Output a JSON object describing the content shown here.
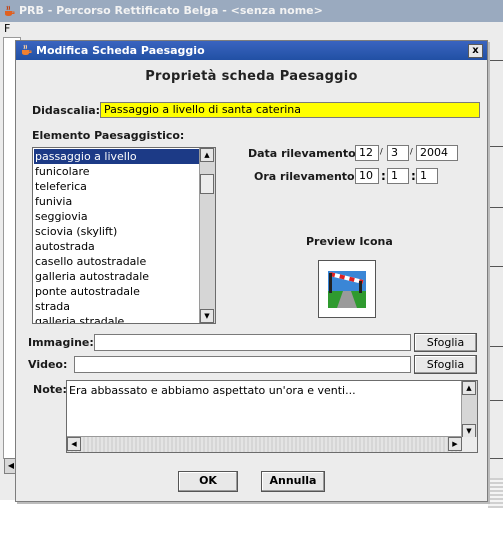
{
  "bg_window": {
    "title": "PRB - Percorso Rettificato Belga - <senza nome>",
    "menu_first_letter": "F"
  },
  "dialog": {
    "title": "Modifica Scheda Paesaggio",
    "close_label": "x",
    "heading": "Proprietà scheda Paesaggio",
    "caption_label": "Didascalia:",
    "caption_value": "Passaggio a livello di santa caterina",
    "element_label": "Elemento Paesaggistico:",
    "elements": [
      "passaggio a livello",
      "funicolare",
      "teleferica",
      "funivia",
      "seggiovia",
      "sciovia (skylift)",
      "autostrada",
      "casello autostradale",
      "galleria autostradale",
      "ponte autostradale",
      "strada",
      "galleria stradale"
    ],
    "selected_index": 0,
    "date_label": "Data rilevamento:",
    "date_day": "12",
    "date_month": "3",
    "date_year": "2004",
    "date_sep": "/",
    "time_label": "Ora rilevamento:",
    "time_h": "10",
    "time_m": "1",
    "time_s": "1",
    "time_sep": ":",
    "preview_label": "Preview Icona",
    "image_label": "Immagine:",
    "image_value": "",
    "video_label": "Video:",
    "video_value": "",
    "browse_label": "Sfoglia",
    "notes_label": "Note:",
    "notes_value": "Era abbassato e abbiamo aspettato un'ora e venti...",
    "ok_label": "OK",
    "cancel_label": "Annulla"
  },
  "colors": {
    "caption_bg": "#ffff00",
    "selection": "#1c3a86",
    "titlebar_active": "#2a58b0",
    "titlebar_inactive": "#9aaabf"
  },
  "icons": {
    "app": "java-cup-icon",
    "preview": "level-crossing-icon"
  }
}
